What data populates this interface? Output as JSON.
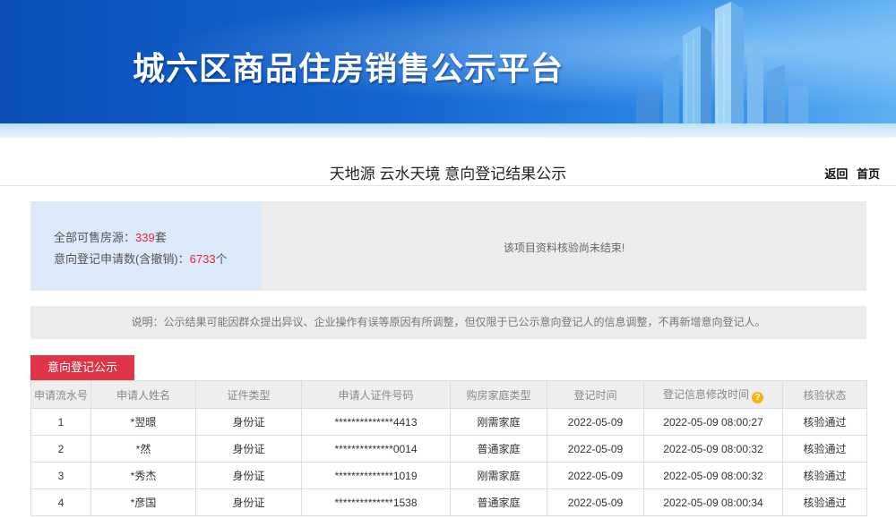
{
  "banner": {
    "title": "城六区商品住房销售公示平台"
  },
  "header": {
    "title": "天地源 云水天境 意向登记结果公示",
    "back": "返回",
    "home": "首页"
  },
  "summary": {
    "available_label": "全部可售房源：",
    "available_value": "339",
    "available_unit": "套",
    "applications_label": "意向登记申请数(含撤销)：",
    "applications_value": "6733",
    "applications_unit": "个",
    "message": "该项目资料核验尚未结束!"
  },
  "note": "说明：公示结果可能因群众提出异议、企业操作有误等原因有所调整，但仅限于已公示意向登记人的信息调整，不再新增意向登记人。",
  "tab": {
    "label": "意向登记公示"
  },
  "table": {
    "headers": [
      "申请流水号",
      "申请人姓名",
      "证件类型",
      "申请人证件号码",
      "购房家庭类型",
      "登记时间",
      "登记信息修改时间",
      "核验状态"
    ],
    "rows": [
      [
        "1",
        "*翌暻",
        "身份证",
        "**************4413",
        "刚需家庭",
        "2022-05-09",
        "2022-05-09 08:00:27",
        "核验通过"
      ],
      [
        "2",
        "*然",
        "身份证",
        "**************0014",
        "普通家庭",
        "2022-05-09",
        "2022-05-09 08:00:32",
        "核验通过"
      ],
      [
        "3",
        "*秀杰",
        "身份证",
        "**************1019",
        "刚需家庭",
        "2022-05-09",
        "2022-05-09 08:00:32",
        "核验通过"
      ],
      [
        "4",
        "*彦国",
        "身份证",
        "**************1538",
        "普通家庭",
        "2022-05-09",
        "2022-05-09 08:00:34",
        "核验通过"
      ]
    ]
  },
  "colors": {
    "banner_blue": "#1565d0",
    "accent_red": "#e03447",
    "number_red": "#e0283a",
    "help_icon": "#f5b50f"
  },
  "icons": {
    "help": "question-circle-icon"
  }
}
